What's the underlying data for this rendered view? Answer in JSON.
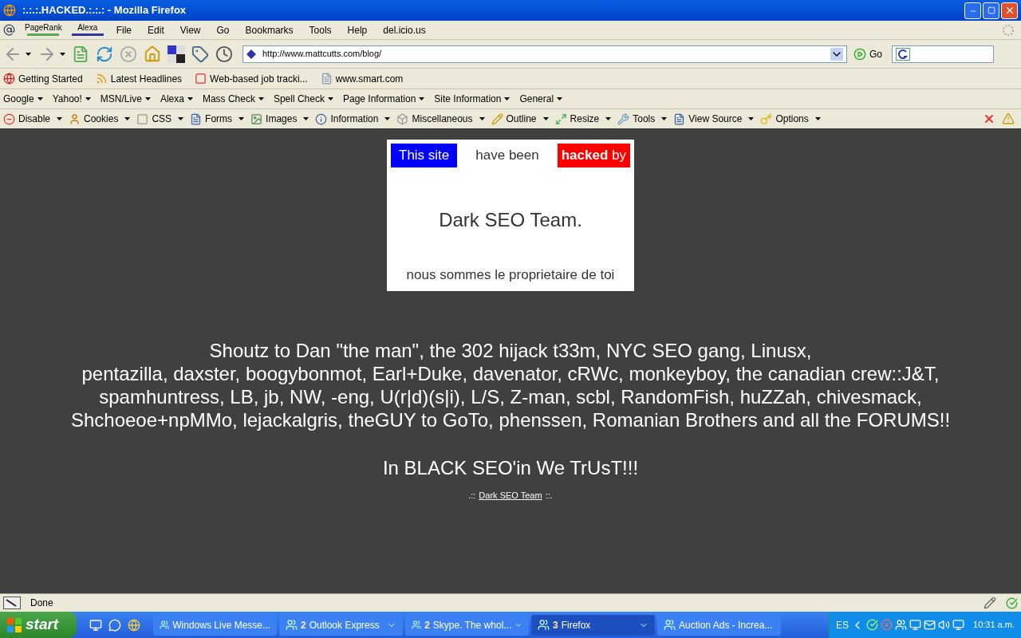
{
  "window": {
    "title": ":.:.:.HACKED.:.:.: - Mozilla Firefox"
  },
  "menu_bar": {
    "pagerank": "PageRank",
    "alexa": "Alexa",
    "items": [
      "File",
      "Edit",
      "View",
      "Go",
      "Bookmarks",
      "Tools",
      "Help",
      "del.icio.us"
    ]
  },
  "nav_toolbar": {
    "url": "http://www.mattcutts.com/blog/",
    "go": "Go"
  },
  "bookmarks": [
    "Getting Started",
    "Latest Headlines",
    "Web-based job tracki...",
    "www.smart.com"
  ],
  "search_toolbar": [
    "Google",
    "Yahoo!",
    "MSN/Live",
    "Alexa",
    "Mass Check",
    "Spell Check",
    "Page Information",
    "Site Information",
    "General"
  ],
  "dev_toolbar": [
    "Disable",
    "Cookies",
    "CSS",
    "Forms",
    "Images",
    "Information",
    "Miscellaneous",
    "Outline",
    "Resize",
    "Tools",
    "View Source",
    "Options"
  ],
  "page": {
    "banner": {
      "this_site": "This site",
      "have_been": "have been",
      "hacked_by": "**hacked** by"
    },
    "team": "Dark SEO Team.",
    "tagline": "nous sommes le proprietaire de toi",
    "shoutz": [
      "Shoutz to Dan \"the man\", the 302 hijack t33m, NYC SEO gang, Linusx,",
      "pentazilla, daxster, boogybonmot, Earl+Duke, davenator, cRWc, monkeyboy, the canadian crew::J&T,",
      "spamhuntress, LB, jb, NW, -eng, U(r|d)(s|i), L/S, Z-man, scbl, RandomFish, huZZah, chivesmack,",
      "Shchoeoe+npMMo, lejackalgris, theGUY to GoTo, phenssen, Romanian Brothers and all the FORUMS!!"
    ],
    "motto": "In BLACK SEO'in We TrUsT!!!",
    "footer": {
      "prefix": ".::",
      "link": "Dark SEO Team",
      "suffix": "::."
    }
  },
  "status_bar": {
    "text": "Done"
  },
  "taskbar": {
    "start": "start",
    "tasks": [
      {
        "label": "Windows Live Messe...",
        "group": false,
        "selected": false
      },
      {
        "count": "2",
        "label": "Outlook Express",
        "group": true,
        "selected": false
      },
      {
        "count": "2",
        "label": "Skype. The whol...",
        "group": true,
        "selected": false
      },
      {
        "count": "3",
        "label": "Firefox",
        "group": true,
        "selected": true
      },
      {
        "label": "Auction Ads - Increa...",
        "group": false,
        "selected": false
      }
    ],
    "language": "ES",
    "clock": "10:31 a.m."
  }
}
